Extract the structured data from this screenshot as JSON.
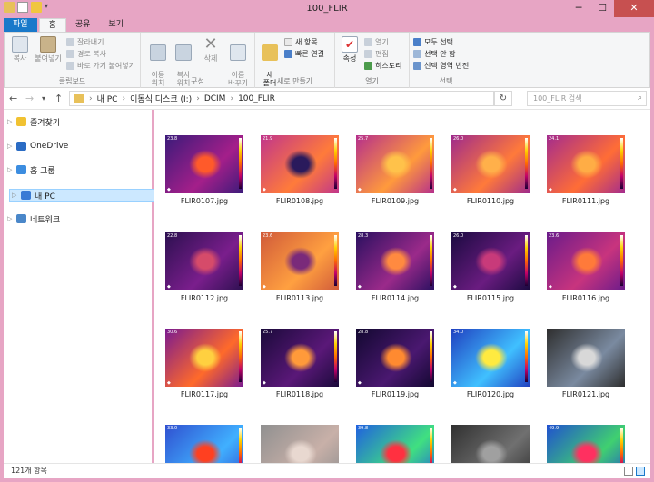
{
  "window": {
    "title": "100_FLIR",
    "minimize": "─",
    "maximize": "☐",
    "close": "✕"
  },
  "ribbon": {
    "tabs": [
      "파일",
      "홈",
      "공유",
      "보기"
    ],
    "clipboard": {
      "copy": "복사",
      "paste": "붙여넣기",
      "cut": "잘라내기",
      "copy_path": "경로 복사",
      "paste_shortcut": "바로 가기 붙여넣기",
      "label": "클립보드"
    },
    "organize": {
      "move_to": "이동\n위치",
      "copy_to": "복사\n위치",
      "delete": "삭제",
      "rename": "이름\n바꾸기",
      "label": "구성"
    },
    "new": {
      "new_folder": "새\n폴더",
      "new_item": "새 항목",
      "easy_access": "빠른 연결",
      "label": "새로 만들기"
    },
    "open": {
      "properties": "속성",
      "open": "열기",
      "edit": "편집",
      "history": "히스토리",
      "label": "열기"
    },
    "select": {
      "select_all": "모두 선택",
      "select_none": "선택 안 함",
      "invert": "선택 영역 반전",
      "label": "선택"
    }
  },
  "address": {
    "segments": [
      "내 PC",
      "이동식 디스크 (I:)",
      "DCIM",
      "100_FLIR"
    ],
    "search_placeholder": "100_FLIR 검색"
  },
  "nav": [
    {
      "label": "즐겨찾기",
      "icon": "star-icon"
    },
    {
      "label": "OneDrive",
      "icon": "cloud-icon"
    },
    {
      "label": "홈 그룹",
      "icon": "homegroup-icon"
    },
    {
      "label": "내 PC",
      "icon": "computer-icon"
    },
    {
      "label": "네트워크",
      "icon": "network-icon"
    }
  ],
  "files": [
    {
      "name": "FLIR0107.jpg",
      "temp": "23.8"
    },
    {
      "name": "FLIR0108.jpg",
      "temp": "21.9"
    },
    {
      "name": "FLIR0109.jpg",
      "temp": "25.7"
    },
    {
      "name": "FLIR0110.jpg",
      "temp": "26.0"
    },
    {
      "name": "FLIR0111.jpg",
      "temp": "24.1"
    },
    {
      "name": "FLIR0112.jpg",
      "temp": "22.8"
    },
    {
      "name": "FLIR0113.jpg",
      "temp": "23.6"
    },
    {
      "name": "FLIR0114.jpg",
      "temp": "28.3"
    },
    {
      "name": "FLIR0115.jpg",
      "temp": "26.0"
    },
    {
      "name": "FLIR0116.jpg",
      "temp": "23.6"
    },
    {
      "name": "FLIR0117.jpg",
      "temp": "30.6"
    },
    {
      "name": "FLIR0118.jpg",
      "temp": "25.7"
    },
    {
      "name": "FLIR0119.jpg",
      "temp": "28.8"
    },
    {
      "name": "FLIR0120.jpg",
      "temp": "34.0"
    },
    {
      "name": "FLIR0121.jpg",
      "temp": ""
    },
    {
      "name": "",
      "temp": "33.0"
    },
    {
      "name": "",
      "temp": ""
    },
    {
      "name": "",
      "temp": "39.8"
    },
    {
      "name": "",
      "temp": ""
    },
    {
      "name": "",
      "temp": "49.9"
    }
  ],
  "status": {
    "count": "121개 항목"
  },
  "colors": {
    "accent": "#1979ca",
    "titlebar": "#e7a5c4",
    "selection": "#cce8ff"
  }
}
